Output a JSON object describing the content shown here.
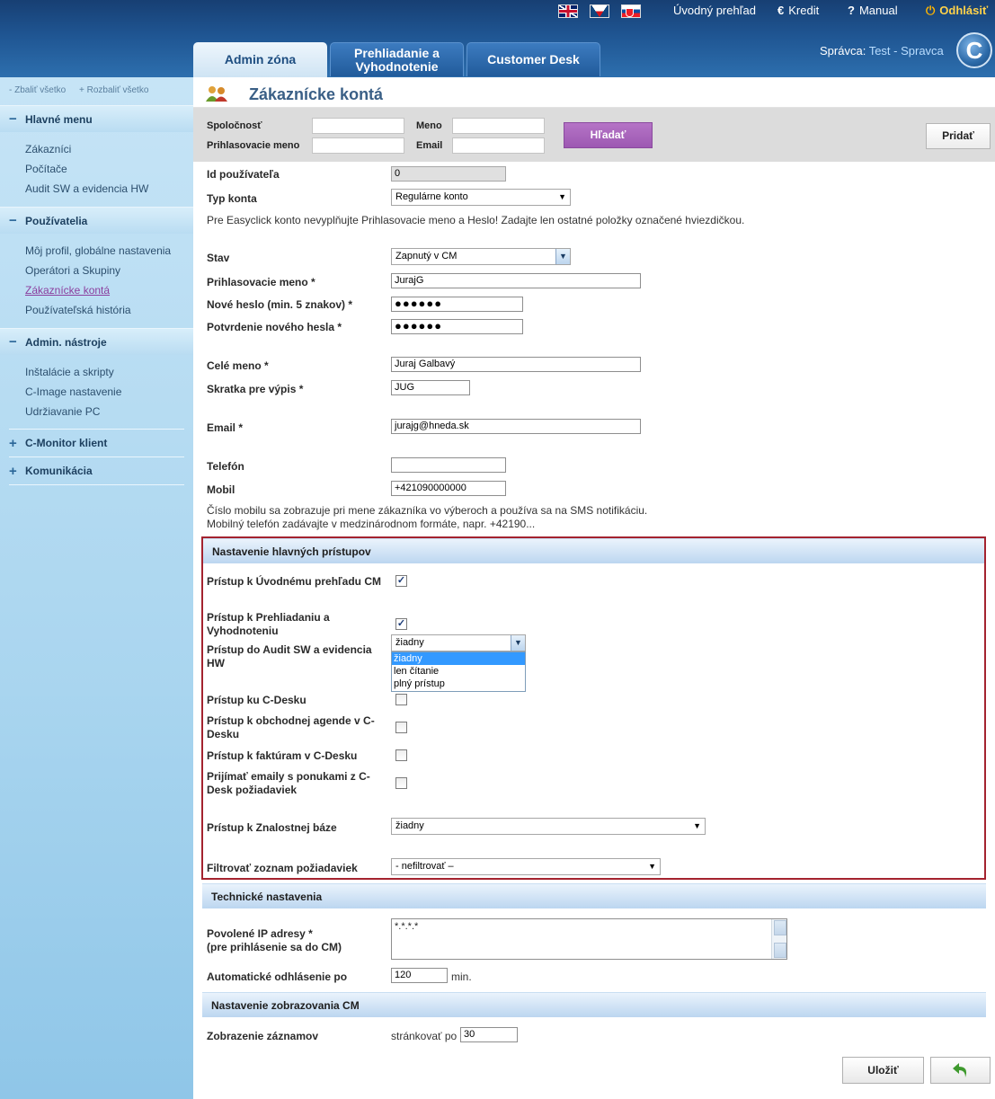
{
  "colors": {
    "header": "#1f5592",
    "accent_purple": "#9d58b2",
    "highlight_red": "#a4232f",
    "sidebar": "#a9d5ef"
  },
  "topbar": {
    "flags": [
      "en-flag-icon",
      "cz-flag-icon",
      "sk-flag-icon"
    ],
    "overview": "Úvodný prehľad",
    "credit": "Kredit",
    "manual": "Manual",
    "logout": "Odhlásiť"
  },
  "tabs": {
    "admin": "Admin zóna",
    "browse_line1": "Prehliadanie a",
    "browse_line2": "Vyhodnotenie",
    "desk": "Customer Desk"
  },
  "user": {
    "label": "Správca:",
    "name": "Test - Spravca"
  },
  "sidebar": {
    "collapse_all": "- Zbaliť všetko",
    "expand_all": "+ Rozbaliť všetko",
    "sections": {
      "main": {
        "title": "Hlavné menu",
        "items": [
          "Zákazníci",
          "Počítače",
          "Audit SW a evidencia HW"
        ]
      },
      "users": {
        "title": "Používatelia",
        "items": [
          "Môj profil, globálne nastavenia",
          "Operátori a Skupiny",
          "Zákaznícke kontá",
          "Používateľská história"
        ]
      },
      "admin_tools": {
        "title": "Admin. nástroje",
        "items": [
          "Inštalácie a skripty",
          "C-Image nastavenie",
          "Udržiavanie PC"
        ]
      },
      "cmonitor": {
        "title": "C-Monitor klient"
      },
      "comm": {
        "title": "Komunikácia"
      }
    }
  },
  "page": {
    "title": "Zákaznícke kontá"
  },
  "search": {
    "company_label": "Spoločnosť",
    "name_label": "Meno",
    "login_label": "Prihlasovacie meno",
    "email_label": "Email",
    "search_button": "Hľadať",
    "add_button": "Pridať"
  },
  "form": {
    "user_id_label": "Id používateľa",
    "user_id_value": "0",
    "account_type_label": "Typ konta",
    "account_type_value": "Regulárne konto",
    "easyclick_note": "Pre Easyclick konto nevyplňujte Prihlasovacie meno a Heslo! Zadajte len ostatné položky označené hviezdičkou.",
    "status_label": "Stav",
    "status_value": "Zapnutý v CM",
    "login_label": "Prihlasovacie meno *",
    "login_value": "JurajG",
    "new_pwd_label": "Nové heslo (min. 5 znakov) *",
    "new_pwd_value": "●●●●●●",
    "confirm_pwd_label": "Potvrdenie nového hesla *",
    "confirm_pwd_value": "●●●●●●",
    "fullname_label": "Celé meno *",
    "fullname_value": "Juraj Galbavý",
    "abbr_label": "Skratka pre výpis *",
    "abbr_value": "JUG",
    "email_label": "Email *",
    "email_value": "jurajg@hneda.sk",
    "phone_label": "Telefón",
    "phone_value": "",
    "mobile_label": "Mobil",
    "mobile_value": "+421090000000",
    "mobile_note1": "Číslo mobilu sa zobrazuje pri mene zákazníka vo výberoch a používa sa na SMS notifikáciu.",
    "mobile_note2": "Mobilný telefón zadávajte v medzinárodnom formáte, napr. +42190..."
  },
  "access": {
    "title": "Nastavenie hlavných prístupov",
    "overview_label": "Prístup k Úvodnému prehľadu CM",
    "overview_checked": true,
    "browse_label_1": "Prístup k Prehliadaniu a",
    "browse_label_2": "Vyhodnoteniu",
    "browse_checked": true,
    "audit_label_1": "Prístup do Audit SW a evidencia",
    "audit_label_2": "HW",
    "audit_value": "žiadny",
    "audit_options": [
      "žiadny",
      "len čítanie",
      "plný prístup"
    ],
    "cdesk_label": "Prístup ku C-Desku",
    "agenda_label_1": "Prístup k obchodnej agende v C-",
    "agenda_label_2": "Desku",
    "invoices_label": "Prístup k faktúram v C-Desku",
    "emails_label_1": "Prijímať emaily s ponukami z C-",
    "emails_label_2": "Desk požiadaviek",
    "kb_label": "Prístup k Znalostnej báze",
    "kb_value": "žiadny",
    "filter_label": "Filtrovať zoznam požiadaviek",
    "filter_value": "- nefiltrovať –"
  },
  "technical": {
    "title": "Technické nastavenia",
    "ip_label_1": "Povolené IP adresy *",
    "ip_label_2": "(pre prihlásenie sa do CM)",
    "ip_value": "*.*.*.*",
    "autologout_label": "Automatické odhlásenie po",
    "autologout_value": "120",
    "autologout_unit": "min."
  },
  "display": {
    "title": "Nastavenie zobrazovania CM",
    "records_label": "Zobrazenie záznamov",
    "paging_label": "stránkovať po",
    "paging_value": "30"
  },
  "actions": {
    "save": "Uložiť"
  }
}
